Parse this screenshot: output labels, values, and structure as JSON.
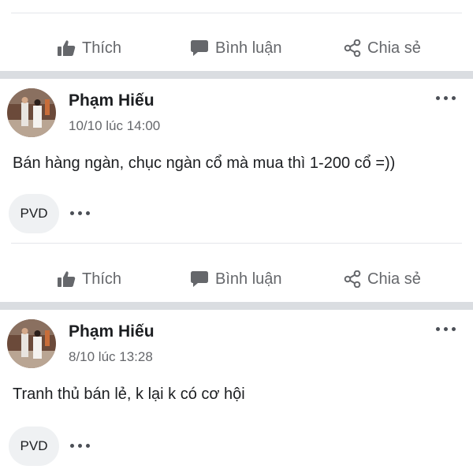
{
  "feed": {
    "actions": {
      "like": "Thích",
      "comment": "Bình luận",
      "share": "Chia sẻ"
    },
    "posts": [
      {
        "author": "Phạm Hiếu",
        "time": "10/10 lúc 14:00",
        "text": "Bán hàng ngàn, chục ngàn cổ mà mua thì 1-200 cổ =))",
        "reaction_label": "PVD"
      },
      {
        "author": "Phạm Hiếu",
        "time": "8/10 lúc 13:28",
        "text": "Tranh thủ bán lẻ, k lại k có cơ hội",
        "reaction_label": "PVD"
      }
    ]
  },
  "colors": {
    "separator": "#dadde1",
    "muted_text": "#65676b",
    "chip_bg": "#eff1f3"
  }
}
